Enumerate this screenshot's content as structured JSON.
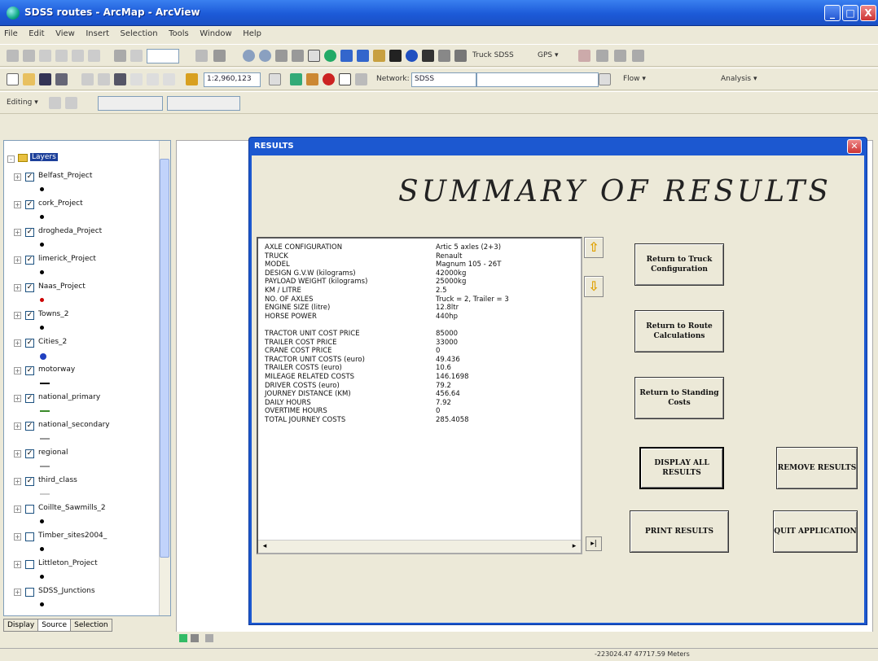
{
  "window": {
    "title": "SDSS routes - ArcMap - ArcView",
    "min": "_",
    "max": "□",
    "close": "X"
  },
  "menu": [
    "File",
    "Edit",
    "View",
    "Insert",
    "Selection",
    "Tools",
    "Window",
    "Help"
  ],
  "toolbar": {
    "scale": "1:2,960,123",
    "network_label": "Network:",
    "network_value": "SDSS",
    "flow_label": "Flow ▾",
    "analysis_label": "Analysis ▾",
    "editing_label": "Editing ▾",
    "gps_label": "GPS ▾",
    "truck_label": "Truck SDSS"
  },
  "toc": {
    "root": "Layers",
    "layers": [
      {
        "name": "Belfast_Project",
        "checked": true,
        "sym": "dot"
      },
      {
        "name": "cork_Project",
        "checked": true,
        "sym": "dot"
      },
      {
        "name": "drogheda_Project",
        "checked": true,
        "sym": "dot"
      },
      {
        "name": "limerick_Project",
        "checked": true,
        "sym": "dot"
      },
      {
        "name": "Naas_Project",
        "checked": true,
        "sym": "dot-red"
      },
      {
        "name": "Towns_2",
        "checked": true,
        "sym": "dot"
      },
      {
        "name": "Cities_2",
        "checked": true,
        "sym": "dot-blue"
      },
      {
        "name": "motorway",
        "checked": true,
        "sym": "line-black"
      },
      {
        "name": "national_primary",
        "checked": true,
        "sym": "line-green"
      },
      {
        "name": "national_secondary",
        "checked": true,
        "sym": "line-gray"
      },
      {
        "name": "regional",
        "checked": true,
        "sym": "line-gray"
      },
      {
        "name": "third_class",
        "checked": true,
        "sym": "line-light"
      },
      {
        "name": "Coillte_Sawmills_2",
        "checked": false,
        "sym": "dot"
      },
      {
        "name": "Timber_sites2004_",
        "checked": false,
        "sym": "dot"
      },
      {
        "name": "Littleton_Project",
        "checked": false,
        "sym": "dot"
      },
      {
        "name": "SDSS_Junctions",
        "checked": false,
        "sym": "dot"
      }
    ],
    "tabs": [
      "Display",
      "Source",
      "Selection"
    ]
  },
  "dialog": {
    "title": "RESULTS",
    "heading": "SUMMARY OF RESULTS",
    "results": [
      {
        "label": "AXLE CONFIGURATION",
        "value": "Artic 5 axles (2+3)"
      },
      {
        "label": "TRUCK",
        "value": "Renault"
      },
      {
        "label": "MODEL",
        "value": "Magnum 105 - 26T"
      },
      {
        "label": "DESIGN G.V.W (kilograms)",
        "value": "42000kg"
      },
      {
        "label": "PAYLOAD WEIGHT (kilograms)",
        "value": "25000kg"
      },
      {
        "label": "KM / LITRE",
        "value": "2.5"
      },
      {
        "label": "NO. OF AXLES",
        "value": "Truck = 2, Trailer = 3"
      },
      {
        "label": "ENGINE SIZE (litre)",
        "value": "12.8ltr"
      },
      {
        "label": "HORSE POWER",
        "value": "440hp"
      },
      {
        "label": "",
        "value": ""
      },
      {
        "label": "TRACTOR UNIT COST PRICE",
        "value": "85000"
      },
      {
        "label": "TRAILER COST PRICE",
        "value": "33000"
      },
      {
        "label": "CRANE COST PRICE",
        "value": "0"
      },
      {
        "label": "TRACTOR UNIT COSTS (euro)",
        "value": "49.436"
      },
      {
        "label": "TRAILER COSTS (euro)",
        "value": "10.6"
      },
      {
        "label": "MILEAGE RELATED COSTS",
        "value": "146.1698"
      },
      {
        "label": "DRIVER COSTS (euro)",
        "value": "79.2"
      },
      {
        "label": "JOURNEY DISTANCE (KM)",
        "value": "456.64"
      },
      {
        "label": "DAILY HOURS",
        "value": "7.92"
      },
      {
        "label": "OVERTIME HOURS",
        "value": "0"
      },
      {
        "label": "TOTAL JOURNEY COSTS",
        "value": "285.4058"
      }
    ],
    "buttons": {
      "return_truck": "Return to Truck Configuration",
      "return_route": "Return to Route Calculations",
      "return_standing": "Return to Standing Costs",
      "display_all": "DISPLAY ALL RESULTS",
      "remove": "REMOVE RESULTS",
      "print": "PRINT RESULTS",
      "quit": "QUIT APPLICATION"
    }
  },
  "status": {
    "coords": "-223024.47  47717.59 Meters"
  },
  "colors": {
    "titlebar": "#1c5ad8",
    "dialog_frame": "#1c58d0",
    "arrow": "#e0a000"
  }
}
